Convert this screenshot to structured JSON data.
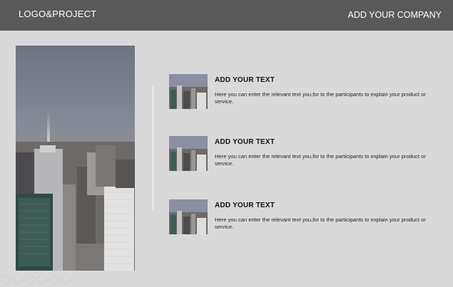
{
  "header": {
    "logo_text": "LOGO&PROJECT",
    "company_text": "ADD YOUR COMPANY"
  },
  "colors": {
    "header_bg": "#595959",
    "page_bg": "#d9d9d9",
    "header_text": "#ffffff"
  },
  "hero_image": {
    "icon": "city-skyline-photo"
  },
  "items": [
    {
      "title": "ADD YOUR TEXT",
      "description": "Here you can enter the relevant text you,for to the participants to explain your product or service."
    },
    {
      "title": "ADD YOUR TEXT",
      "description": "Here you can enter the relevant text you,for to the participants to explain your product or service."
    },
    {
      "title": "ADD YOUR TEXT",
      "description": "Here you can enter the relevant text you,for to the participants to explain your product or service."
    }
  ],
  "slide_controls": [
    {
      "icon": "previous-icon"
    },
    {
      "icon": "next-icon"
    },
    {
      "icon": "pen-icon"
    },
    {
      "icon": "menu-icon"
    },
    {
      "icon": "zoom-icon"
    },
    {
      "icon": "more-icon"
    }
  ]
}
